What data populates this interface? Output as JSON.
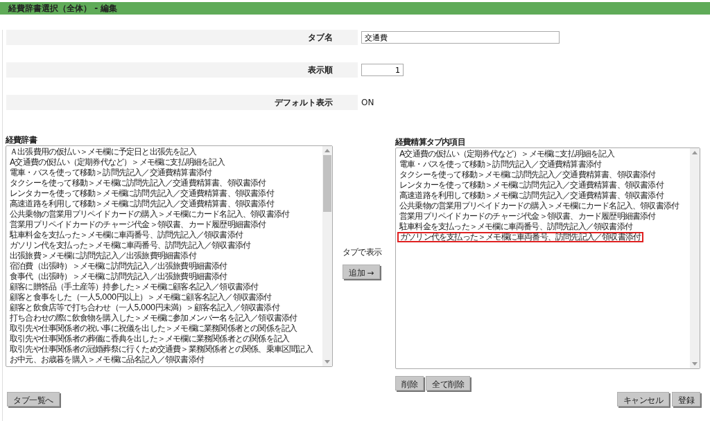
{
  "header": {
    "title": "経費辞書選択（全体） - 編集"
  },
  "form": {
    "tab_name": {
      "label": "タブ名",
      "value": "交通費"
    },
    "order": {
      "label": "表示順",
      "value": "1"
    },
    "default_display": {
      "label": "デフォルト表示",
      "value": "ON"
    }
  },
  "dictionary": {
    "label": "経費辞書",
    "items": [
      {
        "text": "Ａ出張費用の仮払い＞メモ欄に予定日と出張先を記入",
        "highlighted": false
      },
      {
        "text": "A交通費の仮払い（定期券代など）＞メモ欄に支払明細を記入",
        "highlighted": false
      },
      {
        "text": "電車・バスを使って移動＞訪問先記入／交通費精算書添付",
        "highlighted": false
      },
      {
        "text": "タクシーを使って移動＞メモ欄に訪問先記入／交通費精算書、領収書添付",
        "highlighted": false
      },
      {
        "text": "レンタカーを使って移動＞メモ欄に訪問先記入／交通費精算書、領収書添付",
        "highlighted": false
      },
      {
        "text": "高速道路を利用して移動＞メモ欄に訪問先記入／交通費精算書、領収書添付",
        "highlighted": false
      },
      {
        "text": "公共乗物の営業用プリペイドカードの購入＞メモ欄にカード名記入、領収書添付",
        "highlighted": false
      },
      {
        "text": "営業用プリペイドカードのチャージ代金＞領収書、カード履歴明細書添付",
        "highlighted": false
      },
      {
        "text": "駐車料金を支払った＞メモ欄に車両番号、訪問先記入／領収書添付",
        "highlighted": false
      },
      {
        "text": "ガソリン代を支払った＞メモ欄に車両番号、訪問先記入／領収書添付",
        "highlighted": false
      },
      {
        "text": "出張旅費＞メモ欄に訪問先記入／出張旅費明細書添付",
        "highlighted": false
      },
      {
        "text": "宿泊費（出張時）＞メモ欄に訪問先記入／出張旅費明細書添付",
        "highlighted": false
      },
      {
        "text": "食事代（出張時）＞メモ欄に訪問先記入／出張旅費明細書添付",
        "highlighted": false
      },
      {
        "text": "顧客に贈答品（手土産等）持参した＞メモ欄に顧客名記入／領収書添付",
        "highlighted": false
      },
      {
        "text": "顧客と食事をした（一人5,000円以上）＞メモ欄に顧客名記入／領収書添付",
        "highlighted": false
      },
      {
        "text": "顧客と飲食店等で打ち合わせ（一人5,000円未満）＞顧客名記入／領収書添付",
        "highlighted": false
      },
      {
        "text": "打ち合わせの際に飲食物を購入した＞メモ欄に参加メンバー名を記入／領収書添付",
        "highlighted": false
      },
      {
        "text": "取引先や仕事関係者の祝い事に祝儀を出した＞メモ欄に業務関係者との関係を記入",
        "highlighted": false
      },
      {
        "text": "取引先や仕事関係者の葬儀に香典を出した＞メモ欄に業務関係者との関係を記入",
        "highlighted": false
      },
      {
        "text": "取引先や仕事関係者の冠婚葬祭に行くため交通費＞業務関係者との関係、乗車区間記入",
        "highlighted": false
      },
      {
        "text": "お中元、お歳暮を購入＞メモ欄に品名記入／領収書添付",
        "highlighted": false
      }
    ]
  },
  "transfer": {
    "label": "タブで表示",
    "add_button": "追加 →"
  },
  "tab_items": {
    "label": "経費精算タブ内項目",
    "items": [
      {
        "text": "A交通費の仮払い（定期券代など）＞メモ欄に支払明細を記入",
        "highlighted": false
      },
      {
        "text": "電車・バスを使って移動＞訪問先記入／交通費精算書添付",
        "highlighted": false
      },
      {
        "text": "タクシーを使って移動＞メモ欄に訪問先記入／交通費精算書、領収書添付",
        "highlighted": false
      },
      {
        "text": "レンタカーを使って移動＞メモ欄に訪問先記入／交通費精算書、領収書添付",
        "highlighted": false
      },
      {
        "text": "高速道路を利用して移動＞メモ欄に訪問先記入／交通費精算書、領収書添付",
        "highlighted": false
      },
      {
        "text": "公共乗物の営業用プリペイドカードの購入＞メモ欄にカード名記入、領収書添付",
        "highlighted": false
      },
      {
        "text": "営業用プリペイドカードのチャージ代金＞領収書、カード履歴明細書添付",
        "highlighted": false
      },
      {
        "text": "駐車料金を支払った＞メモ欄に車両番号、訪問先記入／領収書添付",
        "highlighted": false
      },
      {
        "text": "ガソリン代を支払った＞メモ欄に車両番号、訪問先記入／領収書添付",
        "highlighted": true
      }
    ],
    "buttons": [
      "削除",
      "全て削除"
    ]
  },
  "footer": {
    "back_button": "タブ一覧へ",
    "buttons": [
      "キャンセル",
      "登録"
    ]
  }
}
